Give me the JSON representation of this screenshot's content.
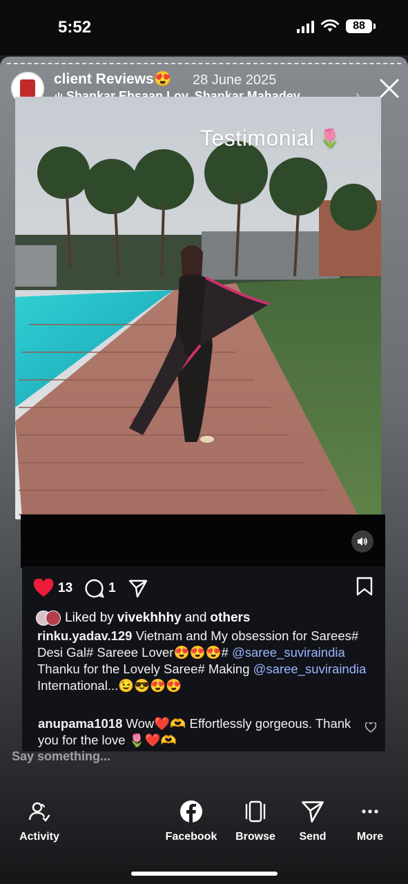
{
  "status_bar": {
    "time": "5:52",
    "battery": "88"
  },
  "story": {
    "title": "client Reviews😍",
    "date": "28 June 2025",
    "music": "Shankar Ehsaan Loy, Shankar Mahadev...",
    "overlay_text": "Testimonial",
    "overlay_emoji": "🌷"
  },
  "post": {
    "likes": "13",
    "comments": "1",
    "liked_by_prefix": "Liked by",
    "liked_by_user": "vivekhhhy",
    "liked_by_and": "and",
    "liked_by_others": "others",
    "caption_user": "rinku.yadav.129",
    "caption_part1": "Vietnam and My obsession for Sarees# Desi Gal# Sareee Lover😍😍😍#",
    "caption_mention1": "@saree_suviraindia",
    "caption_part2": "Thanku for the Lovely Saree# Making",
    "caption_mention2": "@saree_suviraindia",
    "caption_part3": "International...😉😎😍😍",
    "comment_user": "anupama1018",
    "comment_text": "Wow❤️🫶 Effortlessly gorgeous. Thank you for the love 🌷❤️🫶"
  },
  "reply_placeholder": "Say something...",
  "bottom_nav": {
    "activity": "Activity",
    "facebook": "Facebook",
    "browse": "Browse",
    "send": "Send",
    "more": "More"
  }
}
